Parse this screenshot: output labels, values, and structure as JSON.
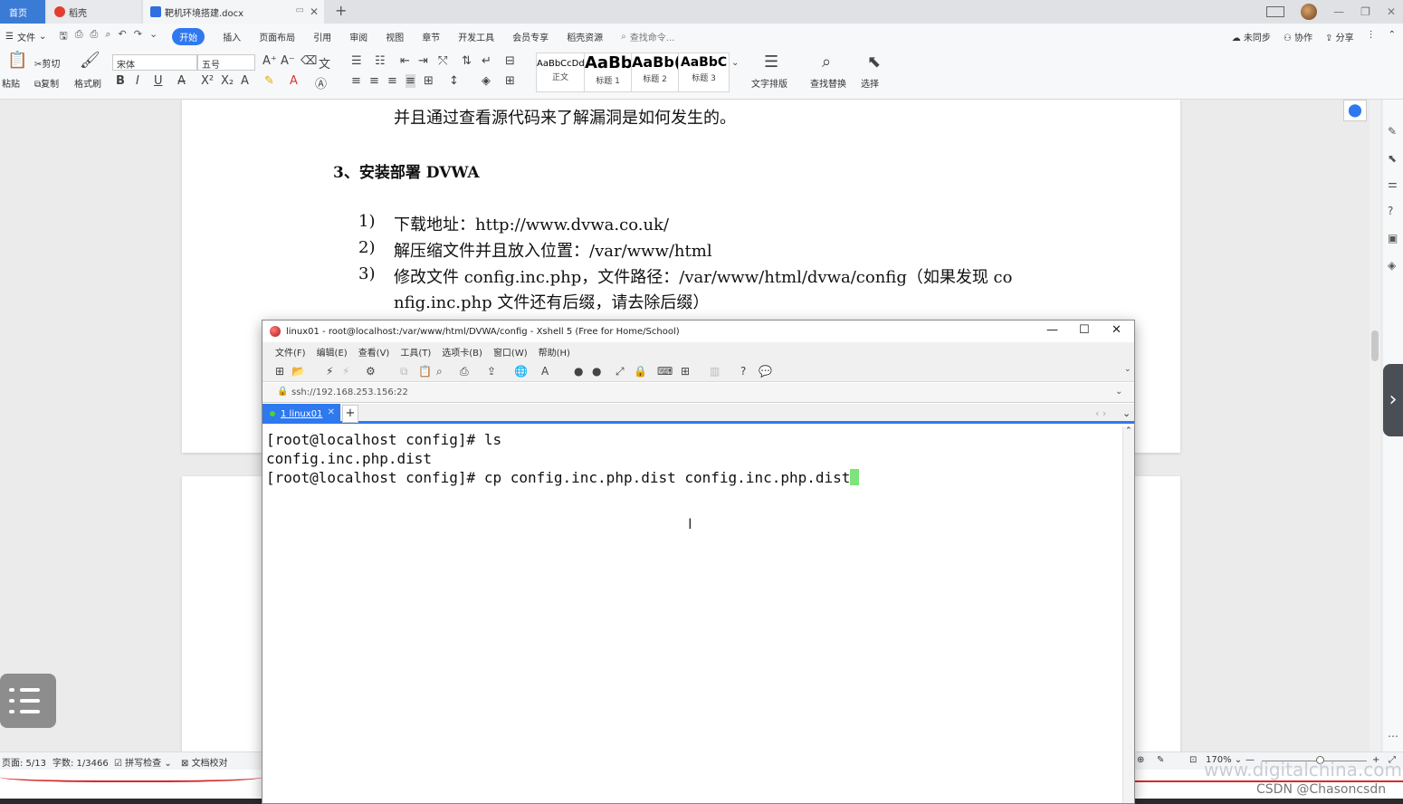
{
  "wps": {
    "tabs": {
      "home": "首页",
      "daoke": "稻壳",
      "doc": "靶机环境搭建.docx"
    },
    "menu": {
      "file": "文件",
      "items": [
        "开始",
        "插入",
        "页面布局",
        "引用",
        "审阅",
        "视图",
        "章节",
        "开发工具",
        "会员专享",
        "稻壳资源"
      ],
      "active": "开始",
      "search_placeholder": "查找命令...",
      "right": [
        "未同步",
        "协作",
        "分享"
      ]
    },
    "ribbon": {
      "paste": "粘贴",
      "cut": "剪切",
      "copy": "复制",
      "format_painter": "格式刷",
      "font_name": "宋体",
      "font_size": "五号",
      "styles": [
        {
          "sample": "AaBbCcDd",
          "name": "正文"
        },
        {
          "sample": "AaBb",
          "name": "标题 1"
        },
        {
          "sample": "AaBb(",
          "name": "标题 2"
        },
        {
          "sample": "AaBbC",
          "name": "标题 3"
        }
      ],
      "text_layout": "文字排版",
      "find_replace": "查找替换",
      "select": "选择"
    },
    "doc": {
      "line0": "并且通过查看源代码来了解漏洞是如何发生的。",
      "heading": "3、安装部署 DVWA",
      "items": [
        {
          "num": "1)",
          "text": "下载地址：http://www.dvwa.co.uk/"
        },
        {
          "num": "2)",
          "text": "解压缩文件并且放入位置：/var/www/html"
        },
        {
          "num": "3)",
          "text": "修改文件 config.inc.php，文件路径：/var/www/html/dvwa/config（如果发现 co"
        }
      ],
      "item3_cont": "nfig.inc.php 文件还有后缀，请去除后缀）"
    },
    "status": {
      "page": "页面: 5/13",
      "words": "字数: 1/3466",
      "spell": "拼写检查",
      "proof": "文档校对",
      "zoom": "170%"
    },
    "watermark": "www.digitalchina.com",
    "csdn": "CSDN @Chasoncsdn"
  },
  "xshell": {
    "title": "linux01 - root@localhost:/var/www/html/DVWA/config - Xshell 5 (Free for Home/School)",
    "menu": [
      "文件(F)",
      "编辑(E)",
      "查看(V)",
      "工具(T)",
      "选项卡(B)",
      "窗口(W)",
      "帮助(H)"
    ],
    "address": "ssh://192.168.253.156:22",
    "tab_label": "1 linux01",
    "terminal": [
      "[root@localhost config]# ls",
      "config.inc.php.dist",
      "[root@localhost config]# cp config.inc.php.dist config.inc.php.dist"
    ]
  }
}
